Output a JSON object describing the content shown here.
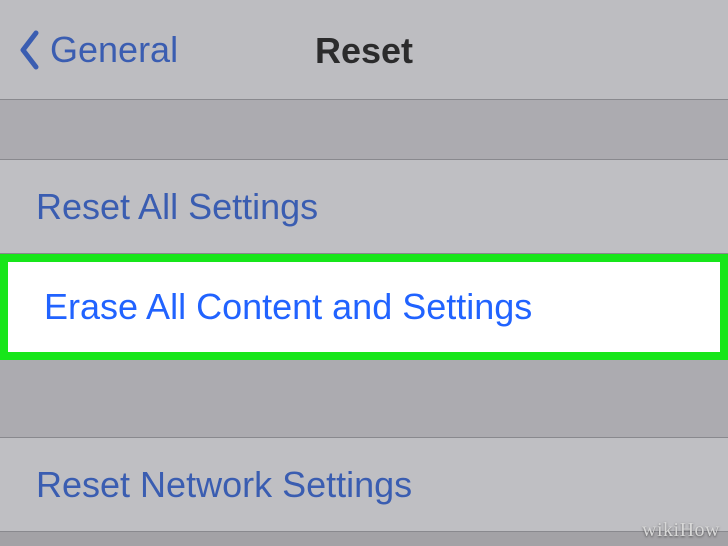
{
  "nav": {
    "back_label": "General",
    "title": "Reset"
  },
  "items": {
    "reset_all": "Reset All Settings",
    "erase_all": "Erase All Content and Settings",
    "reset_network": "Reset Network Settings"
  },
  "watermark": "wikiHow"
}
